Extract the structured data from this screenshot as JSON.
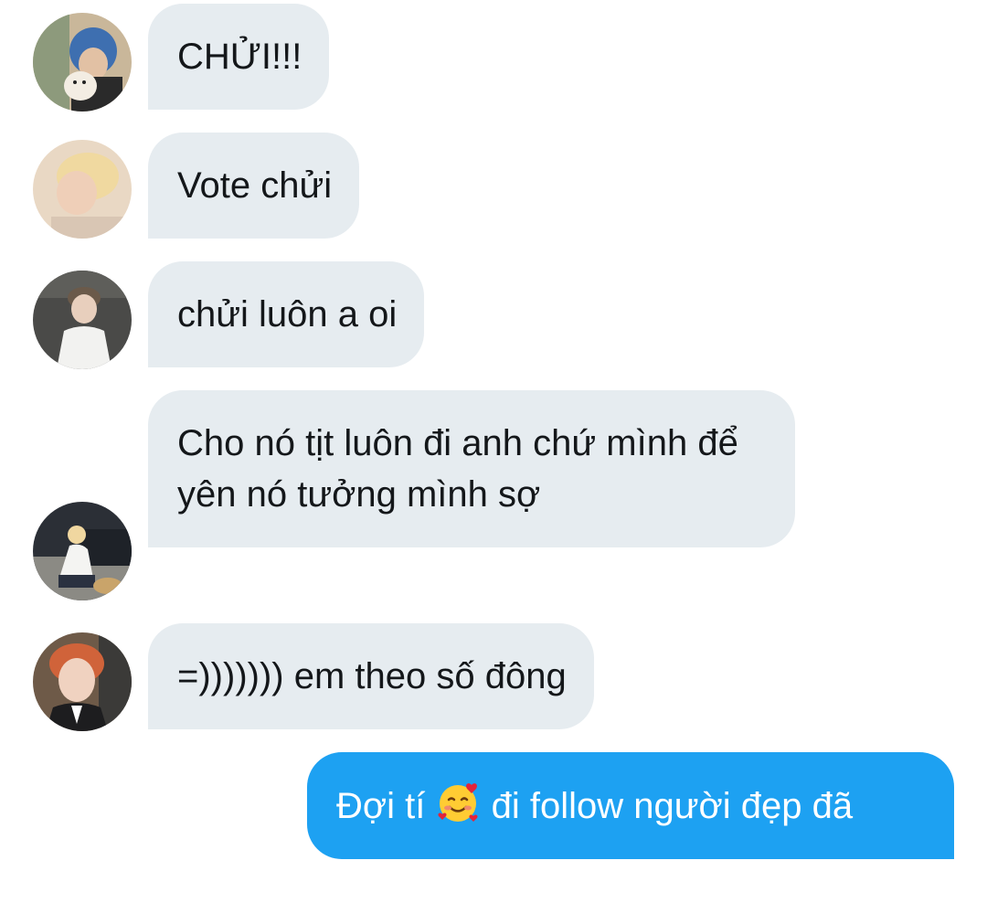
{
  "conversation": {
    "messages": [
      {
        "sender": "incoming",
        "text": "CHỬI!!!",
        "avatar_icon": "avatar-blue-hair-with-dog"
      },
      {
        "sender": "incoming",
        "text": "Vote chửi",
        "avatar_icon": "avatar-blond-profile"
      },
      {
        "sender": "incoming",
        "text": "chửi luôn a oi",
        "avatar_icon": "avatar-white-shirt"
      },
      {
        "sender": "incoming",
        "text": "Cho nó tịt luôn đi anh chứ mình để yên nó tưởng mình sợ",
        "avatar_icon": "avatar-crouching-by-car"
      },
      {
        "sender": "incoming",
        "text": "=))))))) em theo số đông",
        "avatar_icon": "avatar-red-hair-selfie"
      },
      {
        "sender": "outgoing",
        "text_before": "Đợi tí",
        "emoji_icon": "smiling-face-with-hearts-emoji",
        "text_after": "đi follow người đẹp đã"
      }
    ]
  },
  "colors": {
    "incoming_bubble": "#e6ecf0",
    "outgoing_bubble": "#1da1f2",
    "incoming_text": "#14171a",
    "outgoing_text": "#ffffff"
  }
}
